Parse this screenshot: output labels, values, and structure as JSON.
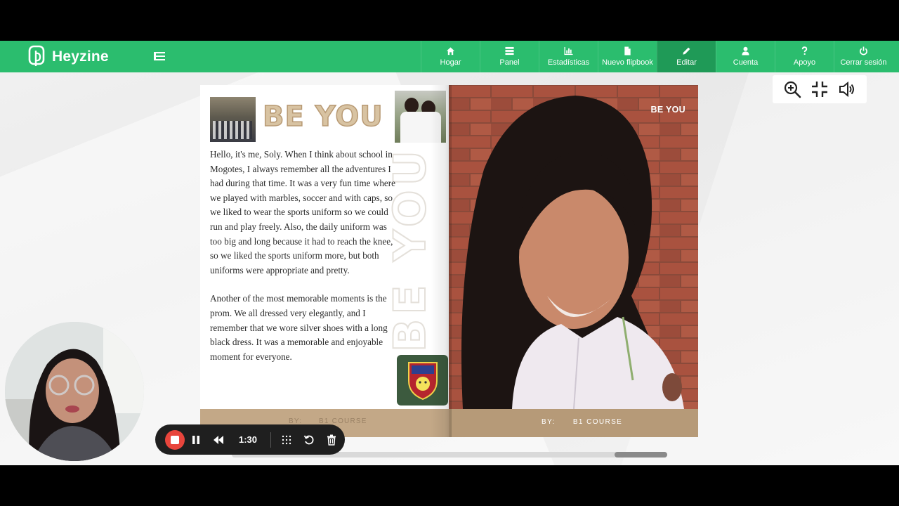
{
  "brand": {
    "name": "Heyzine"
  },
  "nav": {
    "items": [
      {
        "label": "Hogar",
        "icon": "home-icon"
      },
      {
        "label": "Panel",
        "icon": "list-icon"
      },
      {
        "label": "Estadísticas",
        "icon": "bar-chart-icon"
      },
      {
        "label": "Nuevo flipbook",
        "icon": "file-icon"
      },
      {
        "label": "Editar",
        "icon": "pencil-icon",
        "active": true
      },
      {
        "label": "Cuenta",
        "icon": "user-icon"
      },
      {
        "label": "Apoyo",
        "icon": "question-icon"
      },
      {
        "label": "Cerrar sesión",
        "icon": "power-icon"
      }
    ]
  },
  "toolbar": {
    "icons": [
      "zoom-in-icon",
      "collapse-icon",
      "sound-icon"
    ]
  },
  "page_left": {
    "title": "BE YOU",
    "vertical_text": "BE YOU",
    "paragraph1": "Hello, it's me, Soly. When I think about school in Mogotes, I always remember all the adventures I had during that time. It was a very fun time where we played with marbles, soccer and with caps, so we liked to wear the sports uniform so we could run and play freely. Also, the daily uniform was too big and long because it had to reach the knee, so we liked the sports uniform more, but both uniforms were appropriate and pretty.",
    "paragraph2": "Another of the most memorable moments is the prom. We all dressed very elegantly, and I remember that we wore silver shoes with a long black dress. It was a memorable and enjoyable moment for everyone.",
    "footer_by": "BY:",
    "footer_course": "B1 COURSE"
  },
  "page_right": {
    "tag": "BE YOU",
    "footer_by": "BY:",
    "footer_course": "B1 COURSE"
  },
  "recorder": {
    "time": "1:30"
  },
  "colors": {
    "brand_green": "#2bbd6e",
    "active_green": "#1f9a57",
    "tan": "#c3a887",
    "record_red": "#e8453c"
  }
}
